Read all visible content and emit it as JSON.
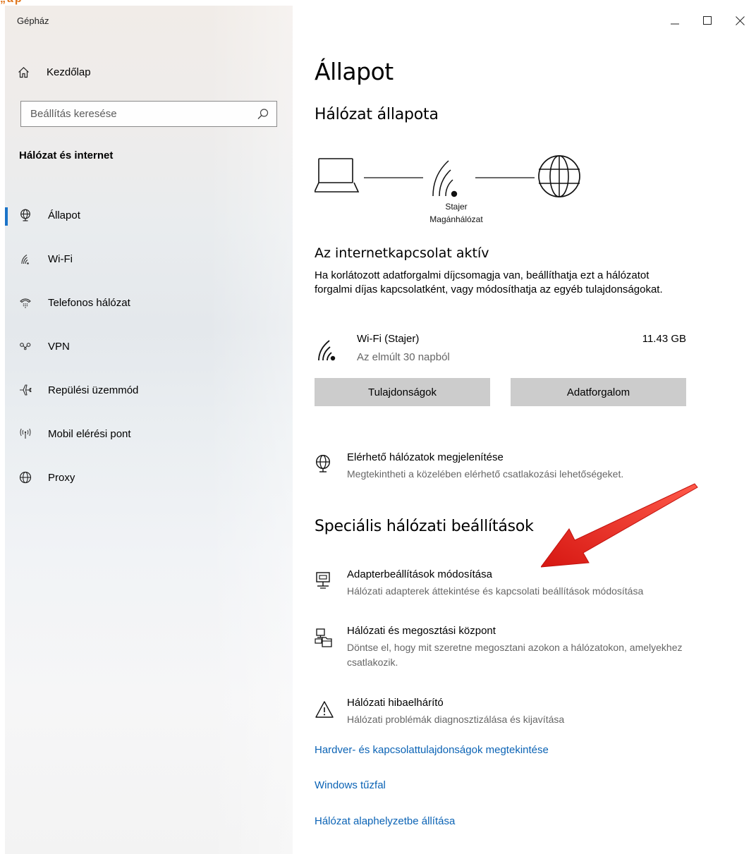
{
  "top_fragment": "„ap",
  "window": {
    "title": "Gépház"
  },
  "sidebar": {
    "home_label": "Kezdőlap",
    "search_placeholder": "Beállítás keresése",
    "section": "Hálózat és internet",
    "items": [
      {
        "label": "Állapot",
        "icon": "globe-network-icon",
        "active": true
      },
      {
        "label": "Wi-Fi",
        "icon": "wifi-icon"
      },
      {
        "label": "Telefonos hálózat",
        "icon": "dialup-icon"
      },
      {
        "label": "VPN",
        "icon": "vpn-icon"
      },
      {
        "label": "Repülési üzemmód",
        "icon": "airplane-icon"
      },
      {
        "label": "Mobil elérési pont",
        "icon": "hotspot-icon"
      },
      {
        "label": "Proxy",
        "icon": "globe-icon"
      }
    ]
  },
  "main": {
    "title": "Állapot",
    "network_status_heading": "Hálózat állapota",
    "network_name": "Stajer",
    "network_type": "Magánhálózat",
    "connection_heading": "Az internetkapcsolat aktív",
    "connection_text": "Ha korlátozott adatforgalmi díjcsomagja van, beállíthatja ezt a hálózatot forgalmi díjas kapcsolatként, vagy módosíthatja az egyéb tulajdonságokat.",
    "usage": {
      "name": "Wi-Fi (Stajer)",
      "period": "Az elmúlt 30 napból",
      "amount": "11.43 GB"
    },
    "buttons": {
      "properties": "Tulajdonságok",
      "data_usage": "Adatforgalom"
    },
    "available_networks": {
      "title": "Elérhető hálózatok megjelenítése",
      "desc": "Megtekintheti a közelében elérhető csatlakozási lehetőségeket."
    },
    "advanced_heading": "Speciális hálózati beállítások",
    "advanced": [
      {
        "title": "Adapterbeállítások módosítása",
        "desc": "Hálózati adapterek áttekintése és kapcsolati beállítások módosítása",
        "icon": "network-adapter-icon"
      },
      {
        "title": "Hálózati és megosztási központ",
        "desc": "Döntse el, hogy mit szeretne megosztani azokon a hálózatokon, amelyekhez csatlakozik.",
        "icon": "sharing-center-icon"
      },
      {
        "title": "Hálózati hibaelhárító",
        "desc": "Hálózati problémák diagnosztizálása és kijavítása",
        "icon": "warning-icon"
      }
    ],
    "links": [
      "Hardver- és kapcsolattulajdonságok megtekintése",
      "Windows tűzfal",
      "Hálózat alaphelyzetbe állítása"
    ]
  },
  "colors": {
    "accent": "#1a73c8",
    "link": "#0b63b5",
    "arrow": "#e8211b",
    "button": "#cccccc"
  }
}
